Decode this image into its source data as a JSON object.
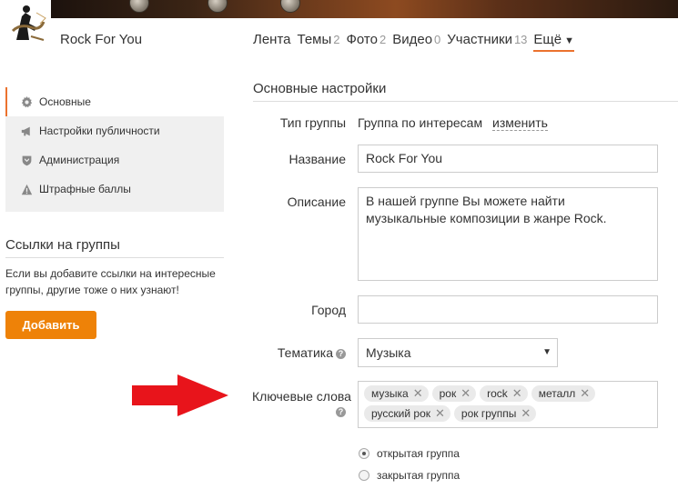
{
  "header": {
    "group_name": "Rock For You",
    "nav": [
      {
        "label": "Лента",
        "count": ""
      },
      {
        "label": "Темы",
        "count": "2"
      },
      {
        "label": "Фото",
        "count": "2"
      },
      {
        "label": "Видео",
        "count": "0"
      },
      {
        "label": "Участники",
        "count": "13"
      }
    ],
    "more_label": "Ещё"
  },
  "sidebar": {
    "items": [
      {
        "label": "Основные",
        "icon": "gear-icon"
      },
      {
        "label": "Настройки публичности",
        "icon": "megaphone-icon"
      },
      {
        "label": "Администрация",
        "icon": "shield-icon"
      },
      {
        "label": "Штрафные баллы",
        "icon": "warning-icon"
      }
    ],
    "links_title": "Ссылки на группы",
    "links_text": "Если вы добавите ссылки на интересные группы, другие тоже о них узнают!",
    "add_button": "Добавить"
  },
  "settings": {
    "title": "Основные настройки",
    "type_label": "Тип группы",
    "type_value": "Группа по интересам",
    "change_link": "изменить",
    "name_label": "Название",
    "name_value": "Rock For You",
    "desc_label": "Описание",
    "desc_value": "В нашей группе Вы можете найти\nмузыкальные композиции в жанре Rock.",
    "city_label": "Город",
    "city_value": "",
    "theme_label": "Тематика",
    "theme_value": "Музыка",
    "keywords_label": "Ключевые слова",
    "keywords": [
      "музыка",
      "рок",
      "rock",
      "металл",
      "русский рок",
      "рок группы"
    ],
    "radio_open": "открытая группа",
    "radio_closed": "закрытая группа",
    "accent_color": "#eb722e",
    "button_color": "#ee8208",
    "arrow_color": "#e8141b"
  }
}
